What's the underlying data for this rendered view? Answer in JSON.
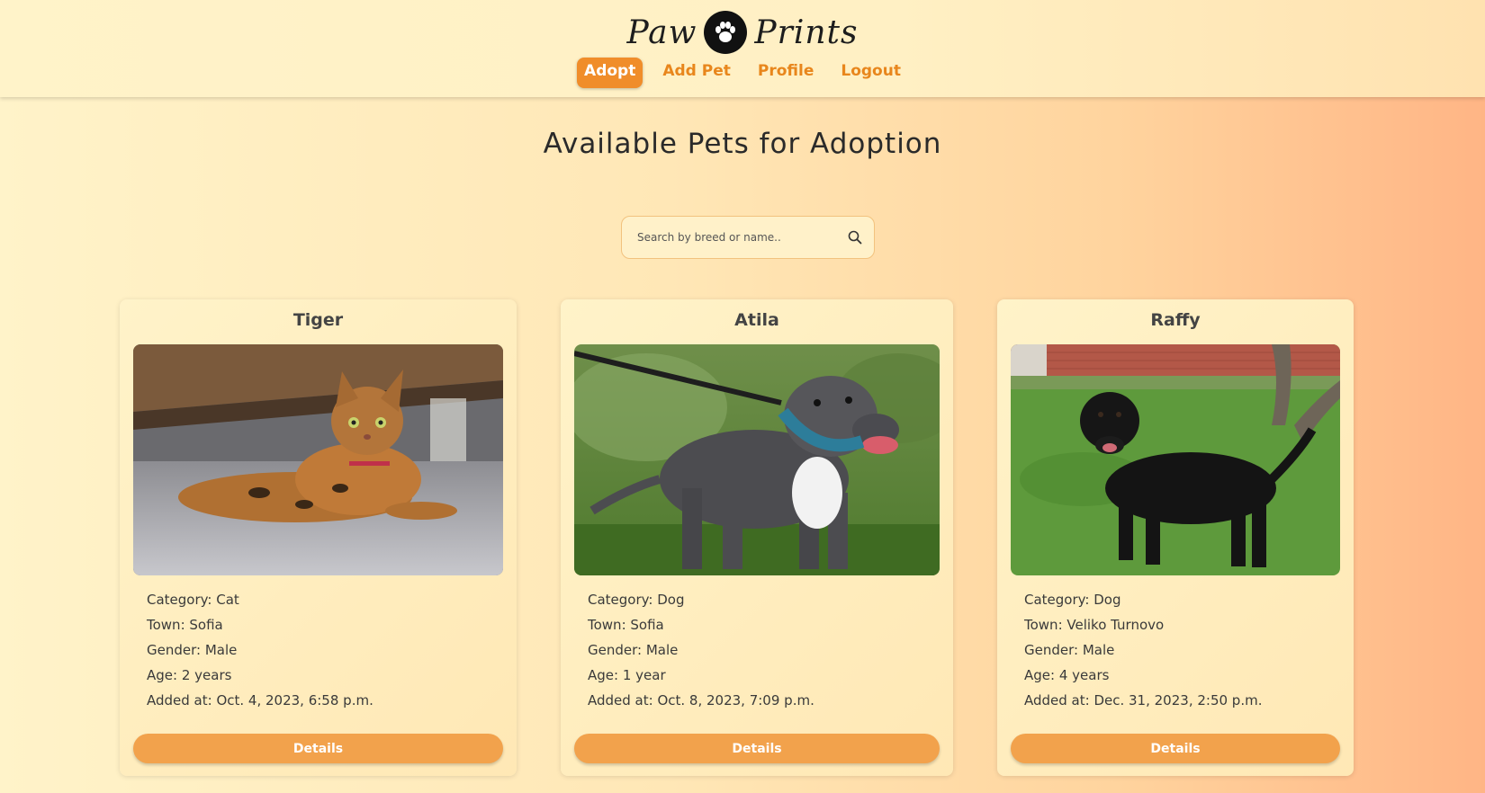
{
  "brand": {
    "left_word": "Paw",
    "right_word": "Prints"
  },
  "nav": {
    "items": [
      {
        "label": "Adopt",
        "active": true
      },
      {
        "label": "Add Pet",
        "active": false
      },
      {
        "label": "Profile",
        "active": false
      },
      {
        "label": "Logout",
        "active": false
      }
    ]
  },
  "main": {
    "title": "Available Pets for Adoption",
    "search": {
      "placeholder": "Search by breed or name..",
      "value": "",
      "icon": "search-icon"
    }
  },
  "pets": [
    {
      "name": "Tiger",
      "category": "Category: Cat",
      "town": "Town: Sofia",
      "gender": "Gender: Male",
      "age": "Age: 2 years",
      "added": "Added at: Oct. 4, 2023, 6:58 p.m.",
      "details_label": "Details"
    },
    {
      "name": "Atila",
      "category": "Category: Dog",
      "town": "Town: Sofia",
      "gender": "Gender: Male",
      "age": "Age: 1 year",
      "added": "Added at: Oct. 8, 2023, 7:09 p.m.",
      "details_label": "Details"
    },
    {
      "name": "Raffy",
      "category": "Category: Dog",
      "town": "Town: Veliko Turnovo",
      "gender": "Gender: Male",
      "age": "Age: 4 years",
      "added": "Added at: Dec. 31, 2023, 2:50 p.m.",
      "details_label": "Details"
    }
  ],
  "colors": {
    "accent": "#f08d2a",
    "button": "#f2a24c",
    "background_start": "#fff3c9",
    "background_end": "#ffb585"
  }
}
